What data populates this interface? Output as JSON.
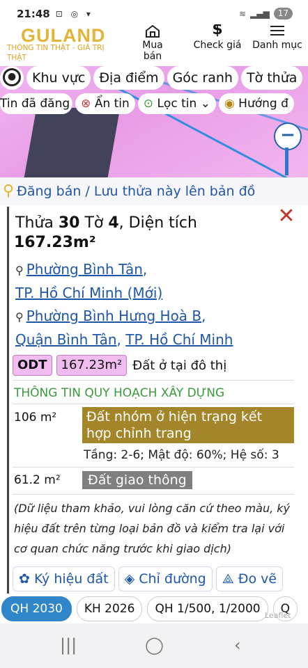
{
  "status_bar": {
    "time": "21:48",
    "battery": "17"
  },
  "header": {
    "logo": "GULAND",
    "slogan": "THÔNG TIN THẬT - GIÁ TRỊ THẬT",
    "nav": [
      {
        "label": "Mua bán",
        "icon": "house-icon"
      },
      {
        "label": "Check giá",
        "icon": "dollar-icon"
      },
      {
        "label": "Danh mục",
        "icon": "menu-icon"
      }
    ]
  },
  "map_chips": [
    "Khu vực",
    "Địa điểm",
    "Góc ranh",
    "Tờ thửa"
  ],
  "map_chips2": {
    "posted": "Tin đã đăng",
    "hide": "Ẩn tin",
    "filter": "Lọc tin",
    "direction": "Hướng đ"
  },
  "zoom_out_label": "−",
  "banner": "Đăng bán / Lưu thửa này lên bản đồ",
  "parcel": {
    "title_prefix": "Thửa",
    "plot_number": "30",
    "sheet_label": "Tờ",
    "sheet_number": "4",
    "area_label": ", Diện tích",
    "area": "167.23m²",
    "close": "✕"
  },
  "address_new": {
    "ward": "Phường Bình Tân",
    "sep": ",",
    "city": "TP. Hồ Chí Minh (Mới)"
  },
  "address_old": {
    "ward": "Phường Bình Hưng Hoà B",
    "sep1": ",",
    "district": "Quận Bình Tân",
    "sep2": ",",
    "city": "TP. Hồ Chí Minh"
  },
  "land_use": {
    "code": "ODT",
    "area": "167.23m²",
    "desc": "Đất ở tại đô thị"
  },
  "planning": {
    "section_title": "THÔNG TIN QUY HOẠCH XÂY DỰNG",
    "zones": [
      {
        "area": "106 m²",
        "name": "Đất nhóm ở hiện trạng kết hợp chỉnh trang",
        "details": "Tầng: 2-6; Mật độ: 60%; Hệ số: 3",
        "color": "#a4862a"
      },
      {
        "area": "61.2 m²",
        "name": "Đất giao thông",
        "color": "#7f7f7f"
      }
    ],
    "note": "(Dữ liệu tham khảo, vui lòng căn cứ theo màu, ký hiệu đất trên từng loại bản đồ và kiểm tra lại với cơ quan chức năng trước khi giao dịch)"
  },
  "actions": [
    "Ký hiệu đất",
    "Chỉ đường",
    "Đo vẽ"
  ],
  "bottom_chips": [
    "QH 2030",
    "KH 2026",
    "QH 1/500, 1/2000",
    "Q"
  ],
  "map_attribution": "Leaflet"
}
